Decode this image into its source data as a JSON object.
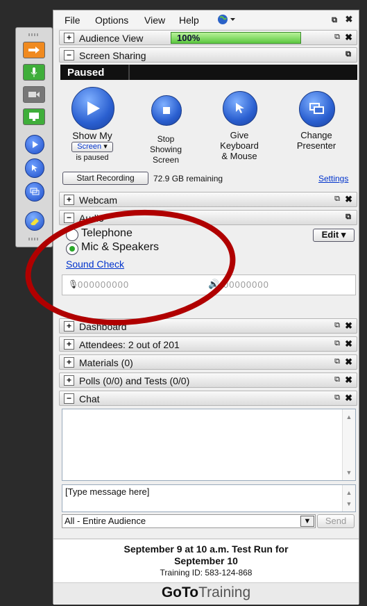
{
  "menu": {
    "file": "File",
    "options": "Options",
    "view": "View",
    "help": "Help"
  },
  "audience_view": {
    "title": "Audience View",
    "level": "100%",
    "level_value": 100
  },
  "screen_sharing": {
    "title": "Screen Sharing",
    "status": "Paused",
    "show_my": "Show My",
    "screen_select": "Screen",
    "is_paused": "is paused",
    "stop_line1": "Stop",
    "stop_line2": "Showing",
    "stop_line3": "Screen",
    "give_line1": "Give",
    "give_line2": "Keyboard",
    "give_line3": "& Mouse",
    "change_line1": "Change",
    "change_line2": "Presenter",
    "start_recording": "Start Recording",
    "remaining": "72.9 GB remaining",
    "settings": "Settings"
  },
  "webcam": {
    "title": "Webcam"
  },
  "audio": {
    "title": "Audio",
    "telephone": "Telephone",
    "mic": "Mic & Speakers",
    "selected": "mic",
    "edit": "Edit",
    "sound_check": "Sound Check",
    "mic_meter": "000000000",
    "speaker_meter": "00000000"
  },
  "sections": {
    "dashboard": "Dashboard",
    "attendees": "Attendees:  2 out of 201",
    "materials": "Materials (0)",
    "polls": "Polls (0/0) and Tests (0/0)",
    "chat": "Chat"
  },
  "chat": {
    "placeholder": "[Type message here]",
    "recipient": "All - Entire Audience",
    "send": "Send"
  },
  "footer": {
    "title_line1": "September 9 at 10 a.m. Test Run for",
    "title_line2": "September 10",
    "training_id": "Training ID: 583-124-868",
    "brand_bold": "GoTo",
    "brand_light": "Training"
  },
  "colors": {
    "accent_green": "#66cc55",
    "link_blue": "#0033cc",
    "annotation_red": "#b00000"
  }
}
